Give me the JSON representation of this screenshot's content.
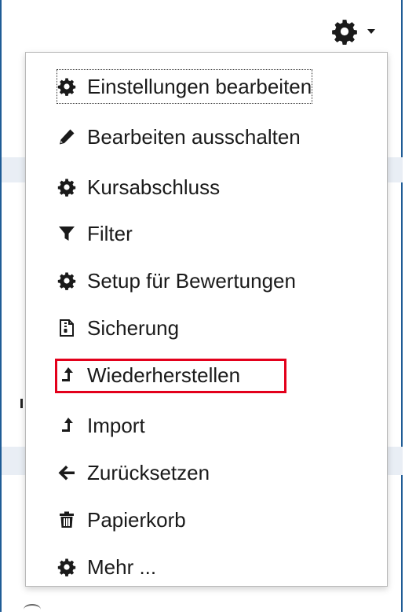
{
  "menu": {
    "items": [
      {
        "label": "Einstellungen bearbeiten",
        "icon": "gear-icon"
      },
      {
        "label": "Bearbeiten ausschalten",
        "icon": "pencil-icon"
      },
      {
        "label": "Kursabschluss",
        "icon": "gear-icon"
      },
      {
        "label": "Filter",
        "icon": "filter-icon"
      },
      {
        "label": "Setup für Bewertungen",
        "icon": "gear-icon"
      },
      {
        "label": "Sicherung",
        "icon": "backup-file-icon"
      },
      {
        "label": "Wiederherstellen",
        "icon": "upload-arrow-icon"
      },
      {
        "label": "Import",
        "icon": "upload-arrow-icon"
      },
      {
        "label": "Zurücksetzen",
        "icon": "arrow-left-icon"
      },
      {
        "label": "Papierkorb",
        "icon": "trash-icon"
      },
      {
        "label": "Mehr ...",
        "icon": "gear-icon"
      }
    ]
  },
  "colors": {
    "highlight": "#e3001b",
    "frame": "#1f5c96",
    "band": "#e9eef5",
    "text": "#1a1a1a"
  }
}
